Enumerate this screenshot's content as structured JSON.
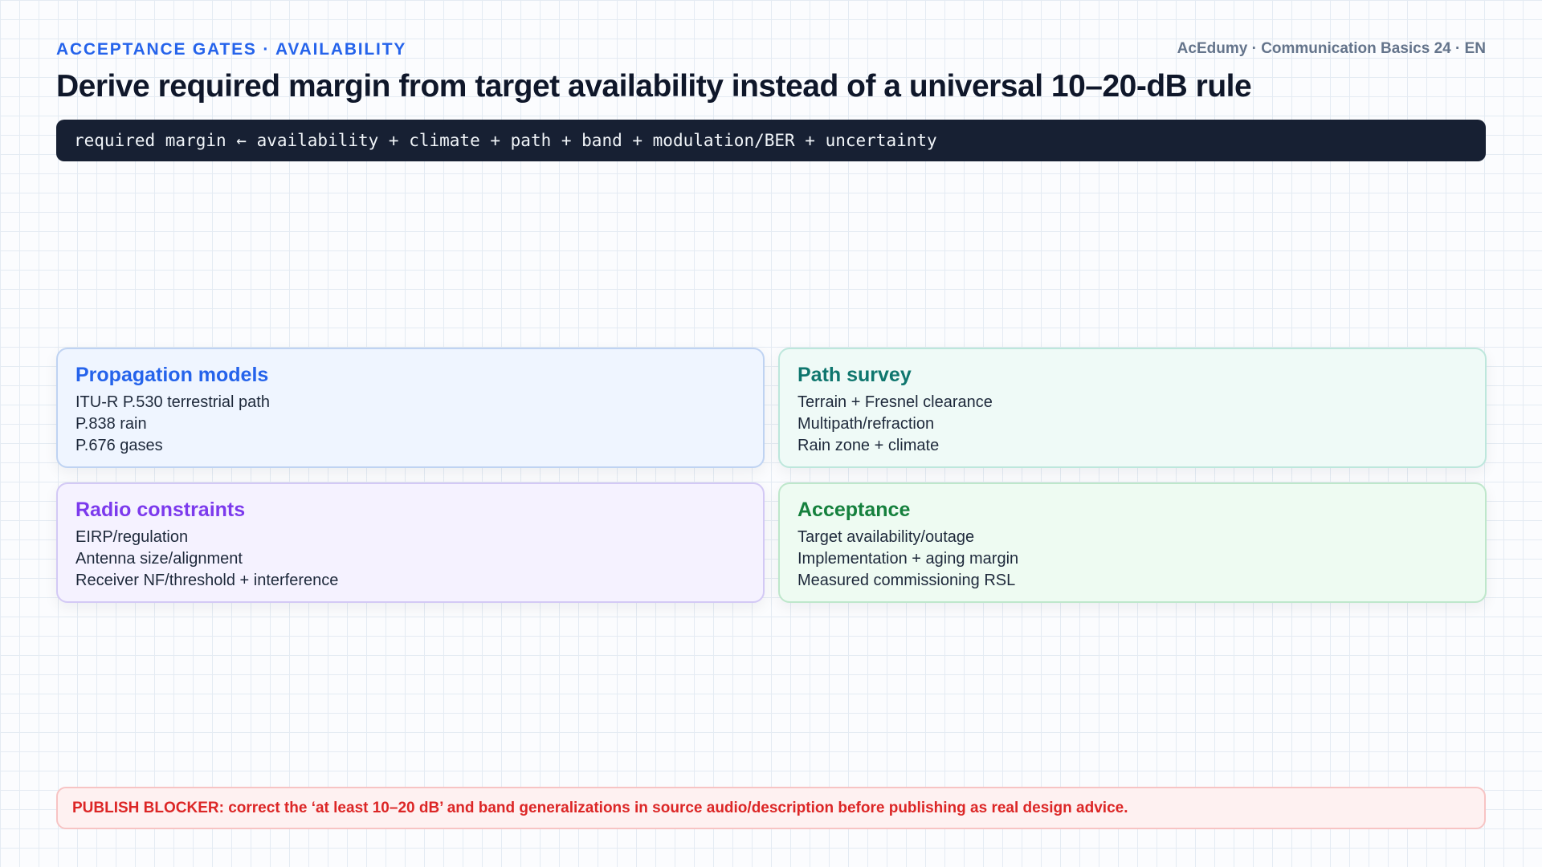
{
  "header": {
    "eyebrow": "ACCEPTANCE GATES · AVAILABILITY",
    "brand": "AcEdumy · Communication Basics 24 · EN",
    "title": "Derive required margin from target availability instead of a universal 10–20-dB rule"
  },
  "formula": "required margin ← availability + climate + path + band + modulation/BER + uncertainty",
  "cards": [
    {
      "title": "Propagation models",
      "lines": [
        "ITU-R P.530 terrestrial path",
        "P.838 rain",
        "P.676 gases"
      ]
    },
    {
      "title": "Path survey",
      "lines": [
        "Terrain + Fresnel clearance",
        "Multipath/refraction",
        "Rain zone + climate"
      ]
    },
    {
      "title": "Radio constraints",
      "lines": [
        "EIRP/regulation",
        "Antenna size/alignment",
        "Receiver NF/threshold + interference"
      ]
    },
    {
      "title": "Acceptance",
      "lines": [
        "Target availability/outage",
        "Implementation + aging margin",
        "Measured commissioning RSL"
      ]
    }
  ],
  "blocker": "PUBLISH BLOCKER: correct the ‘at least 10–20 dB’ and band generalizations in source audio/description before publishing as real design advice.",
  "colors": {
    "accent_blue": "#2563eb",
    "teal": "#0f766e",
    "purple": "#7c3aed",
    "green": "#15803d",
    "danger_red": "#dc2626",
    "formula_bg": "#172033"
  }
}
